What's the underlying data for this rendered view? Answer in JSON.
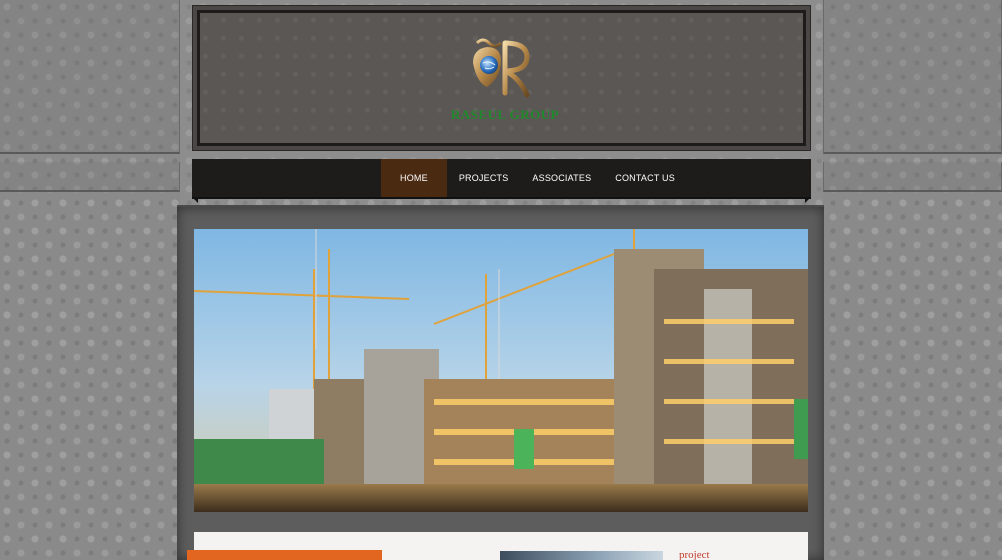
{
  "brand": {
    "logo_icon": "rr-monogram-globe-icon",
    "name": "RASEUL GROUP",
    "color": "#1f8a2a"
  },
  "nav": {
    "items": [
      {
        "label": "HOME",
        "active": true
      },
      {
        "label": "PROJECTS",
        "active": false
      },
      {
        "label": "ASSOCIATES",
        "active": false
      },
      {
        "label": "CONTACT US",
        "active": false
      }
    ],
    "active_color": "#4b2a12"
  },
  "hero": {
    "image": "construction-site-cranes-image"
  },
  "lower": {
    "accent_color": "#e2661f",
    "project_link": "project"
  }
}
